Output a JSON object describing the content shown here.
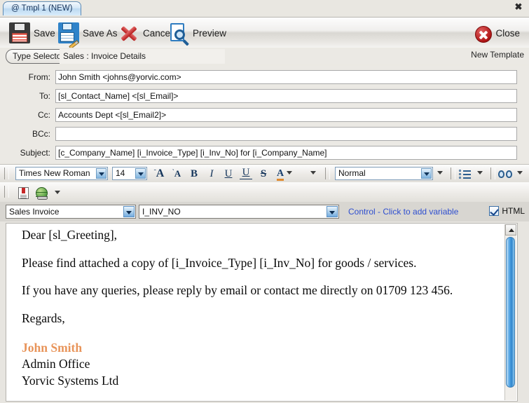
{
  "window": {
    "tab_label": "@ Tmpl 1 (NEW)",
    "close_glyph": "✖"
  },
  "toolbar": {
    "save_label": "Save",
    "save_as_label": "Save As",
    "cancel_label": "Cancel",
    "preview_label": "Preview",
    "close_label": "Close"
  },
  "type_row": {
    "type_selector_label": "Type Selector",
    "type_value": "Sales : Invoice Details",
    "new_template_label": "New Template"
  },
  "address_fields": [
    {
      "label": "From:",
      "value": "John Smith <johns@yorvic.com>"
    },
    {
      "label": "To:",
      "value": "[sl_Contact_Name] <[sl_Email]>"
    },
    {
      "label": "Cc:",
      "value": "Accounts Dept <[sl_Email2]>"
    },
    {
      "label": "BCc:",
      "value": ""
    },
    {
      "label": "Subject:",
      "value": "[c_Company_Name] [i_Invoice_Type] [i_Inv_No] for [i_Company_Name]"
    }
  ],
  "format_toolbar": {
    "font_family": "Times New Roman",
    "font_size": "14",
    "grow_font": "A",
    "shrink_font": "A",
    "bold": "B",
    "italic": "I",
    "underline": "U",
    "double_underline": "U",
    "strikethrough": "S",
    "font_color": "A",
    "style": "Normal",
    "bullets_icon": "bulleted-list-icon",
    "find_icon": "binoculars-icon",
    "insert_doc_icon": "document-icon",
    "hyperlink_icon": "globe-link-icon"
  },
  "variable_bar": {
    "source": "Sales Invoice",
    "variable": "I_INV_NO",
    "hint": "Control - Click to add variable",
    "html_label": "HTML",
    "html_checked": true,
    "hint_color": "#2f4fd0"
  },
  "body": {
    "greeting": "Dear [sl_Greeting],",
    "paragraph1": "Please find attached a copy of [i_Invoice_Type] [i_Inv_No] for goods / services.",
    "paragraph2": "If you have any queries, please reply by email or contact me directly on 01709 123 456.",
    "closing": "Regards,",
    "signature_name": "John Smith",
    "signature_role": "Admin Office",
    "signature_company": "Yorvic Systems Ltd",
    "signature_color": "#e8945a"
  }
}
